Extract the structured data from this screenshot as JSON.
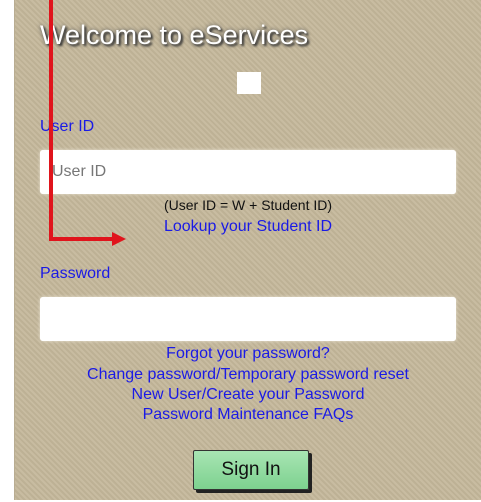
{
  "login": {
    "title": "Welcome to eServices",
    "user_id_label": "User ID",
    "user_id_placeholder": "User ID",
    "user_id_value": "",
    "user_id_hint": "(User ID = W + Student ID)",
    "lookup_link": "Lookup your Student ID",
    "password_label": "Password",
    "password_value": "",
    "links": {
      "forgot": "Forgot your password?",
      "change": "Change password/Temporary password reset",
      "new_user": "New User/Create your Password",
      "faqs": "Password Maintenance FAQs"
    },
    "sign_in_label": "Sign In"
  },
  "colors": {
    "panel_bg": "#c5b89b",
    "link": "#1a1ae6",
    "annotation_arrow": "#e0141c",
    "sign_in_button": "#8fdc9f"
  },
  "icons": {
    "logo": "logo-placeholder-square",
    "annotation": "red-arrow-annotation"
  }
}
